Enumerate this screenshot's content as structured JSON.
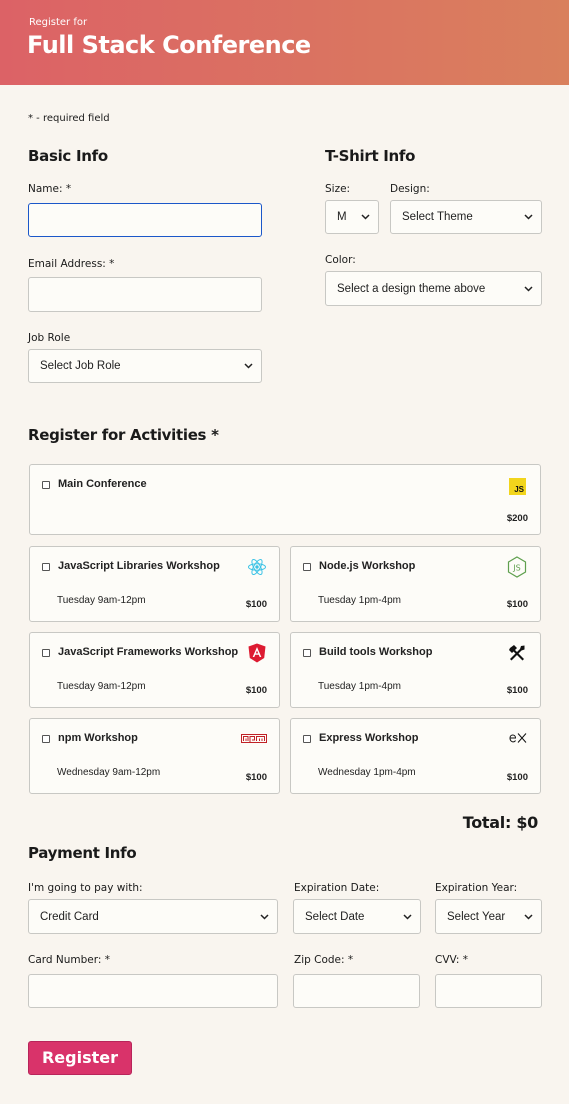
{
  "header": {
    "subtitle": "Register for",
    "title": "Full Stack Conference"
  },
  "required_note": "* - required field",
  "basic_info": {
    "heading": "Basic Info",
    "name_label": "Name: *",
    "name_value": "",
    "email_label": "Email Address: *",
    "email_value": "",
    "job_role_label": "Job Role",
    "job_role_value": "Select Job Role"
  },
  "tshirt": {
    "heading": "T-Shirt Info",
    "size_label": "Size:",
    "size_value": "M",
    "design_label": "Design:",
    "design_value": "Select Theme",
    "color_label": "Color:",
    "color_value": "Select a design theme above"
  },
  "activities": {
    "heading": "Register for Activities *",
    "items": [
      {
        "name": "Main Conference",
        "time": "",
        "price": "$200",
        "icon": "js-icon",
        "checked": false
      },
      {
        "name": "JavaScript Libraries Workshop",
        "time": "Tuesday 9am-12pm",
        "price": "$100",
        "icon": "react-icon",
        "checked": false
      },
      {
        "name": "Node.js Workshop",
        "time": "Tuesday 1pm-4pm",
        "price": "$100",
        "icon": "nodejs-icon",
        "checked": false
      },
      {
        "name": "JavaScript Frameworks Workshop",
        "time": "Tuesday 9am-12pm",
        "price": "$100",
        "icon": "angular-icon",
        "checked": false
      },
      {
        "name": "Build tools Workshop",
        "time": "Tuesday 1pm-4pm",
        "price": "$100",
        "icon": "tools-icon",
        "checked": false
      },
      {
        "name": "npm Workshop",
        "time": "Wednesday 9am-12pm",
        "price": "$100",
        "icon": "npm-icon",
        "checked": false
      },
      {
        "name": "Express Workshop",
        "time": "Wednesday 1pm-4pm",
        "price": "$100",
        "icon": "express-icon",
        "checked": false
      }
    ],
    "total": "Total: $0"
  },
  "payment": {
    "heading": "Payment Info",
    "method_label": "I'm going to pay with:",
    "method_value": "Credit Card",
    "exp_date_label": "Expiration Date:",
    "exp_date_value": "Select Date",
    "exp_year_label": "Expiration Year:",
    "exp_year_value": "Select Year",
    "card_number_label": "Card Number: *",
    "card_number_value": "",
    "zip_label": "Zip Code: *",
    "zip_value": "",
    "cvv_label": "CVV: *",
    "cvv_value": ""
  },
  "submit_label": "Register",
  "colors": {
    "accent": "#d9336a",
    "header_start": "#dc6266",
    "header_end": "#d9805d",
    "focus": "#1b57c9"
  }
}
